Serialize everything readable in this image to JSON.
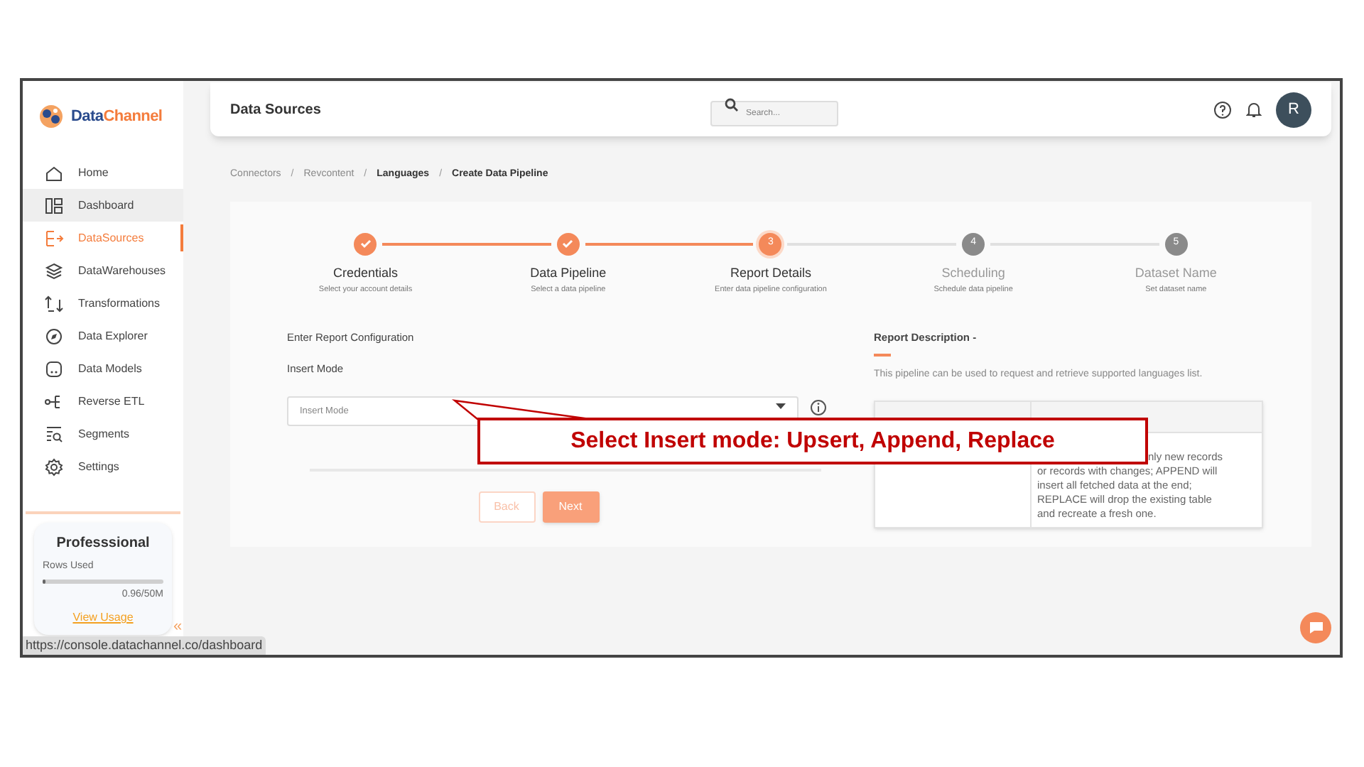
{
  "sidebar": {
    "logo": {
      "part_1": "Data",
      "part_2": "Channel"
    },
    "items": [
      {
        "label": "Home",
        "selected": false,
        "hovered": false
      },
      {
        "label": "Dashboard",
        "selected": false,
        "hovered": true
      },
      {
        "label": "DataSources",
        "selected": true,
        "hovered": false
      },
      {
        "label": "DataWarehouses",
        "selected": false,
        "hovered": false
      },
      {
        "label": "Transformations",
        "selected": false,
        "hovered": false
      },
      {
        "label": "Data Explorer",
        "selected": false,
        "hovered": false
      },
      {
        "label": "Data Models",
        "selected": false,
        "hovered": false
      },
      {
        "label": "Reverse ETL",
        "selected": false,
        "hovered": false
      },
      {
        "label": "Segments",
        "selected": false,
        "hovered": false
      },
      {
        "label": "Settings",
        "selected": false,
        "hovered": false
      }
    ],
    "plan": {
      "title": "Professsional",
      "rows_label": "Rows Used",
      "level": 0.02,
      "usage": "0.96/50M",
      "link": "View Usage"
    },
    "collapse": "«"
  },
  "header": {
    "title": "Data Sources",
    "search_placeholder": "Search...",
    "avatar": "R"
  },
  "breadcrumb_separators": [
    "/",
    "/",
    "/"
  ],
  "breadcrumb": [
    {
      "label": "Connectors",
      "current": false
    },
    {
      "label": "Revcontent",
      "current": false
    },
    {
      "label": "Languages",
      "current": true
    },
    {
      "label": "Create Data Pipeline",
      "current": true
    }
  ],
  "steps": [
    {
      "title": "Credentials",
      "subtitle": "Select your account details",
      "done": true,
      "selected": false
    },
    {
      "title": "Data Pipeline",
      "subtitle": "Select a data pipeline",
      "done": true,
      "selected": false
    },
    {
      "number": "3",
      "title": "Report Details",
      "subtitle": "Enter data pipeline configuration",
      "done": false,
      "selected": true
    },
    {
      "number": "4",
      "title": "Scheduling",
      "subtitle": "Schedule data pipeline",
      "done": false,
      "selected": false
    },
    {
      "number": "5",
      "title": "Dataset Name",
      "subtitle": "Set dataset name",
      "done": false,
      "selected": false
    }
  ],
  "form": {
    "section": "Enter Report Configuration",
    "field_label": "Insert Mode",
    "placeholder": "Insert Mode",
    "buttons": [
      {
        "label": "Back",
        "kind": "secondary"
      },
      {
        "label": "Next",
        "kind": "primary"
      }
    ]
  },
  "description": {
    "title": "Report Description -",
    "text": "This pipeline can be used to request and retrieve supported languages list.",
    "table_cell_lines": [
      "nly new records",
      "or records with changes; APPEND will",
      "insert all fetched data at the end;",
      "REPLACE will drop the existing table",
      "and recreate a fresh one."
    ]
  },
  "status_url": "https://console.datachannel.co/dashboard",
  "callout": "Select Insert mode: Upsert, Append, Replace"
}
